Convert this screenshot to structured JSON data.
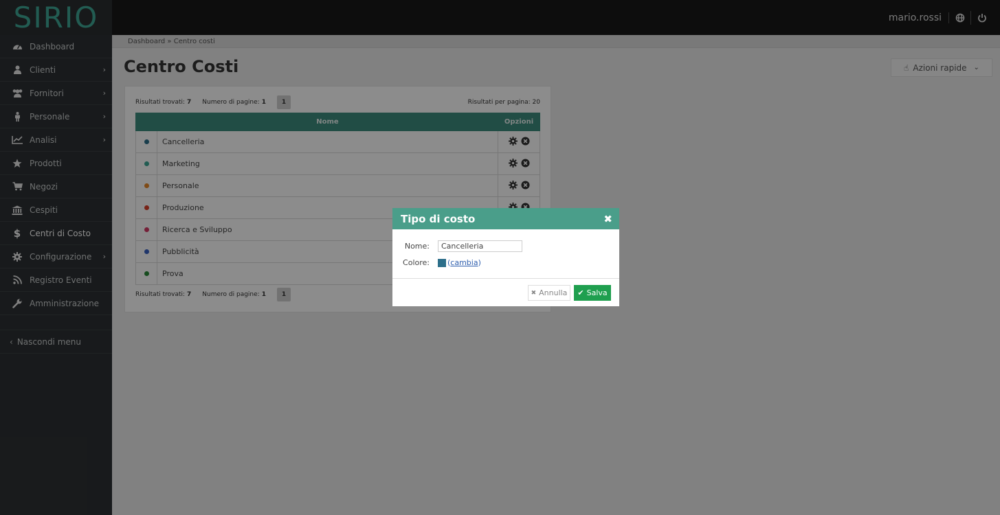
{
  "brand": {
    "logo_text": "SIRIO"
  },
  "header": {
    "username": "mario.rossi",
    "icons": [
      "globe-icon",
      "power-icon"
    ]
  },
  "sidebar": {
    "items": [
      {
        "label": "Dashboard",
        "icon": "dashboard-icon",
        "has_submenu": false
      },
      {
        "label": "Clienti",
        "icon": "user-icon",
        "has_submenu": true
      },
      {
        "label": "Fornitori",
        "icon": "users-icon",
        "has_submenu": true
      },
      {
        "label": "Personale",
        "icon": "person-icon",
        "has_submenu": true
      },
      {
        "label": "Analisi",
        "icon": "chart-line-icon",
        "has_submenu": true
      },
      {
        "label": "Prodotti",
        "icon": "star-icon",
        "has_submenu": false
      },
      {
        "label": "Negozi",
        "icon": "cart-icon",
        "has_submenu": false
      },
      {
        "label": "Cespiti",
        "icon": "bank-icon",
        "has_submenu": false
      },
      {
        "label": "Centri di Costo",
        "icon": "dollar-icon",
        "has_submenu": false,
        "active": true
      },
      {
        "label": "Configurazione",
        "icon": "gear-icon",
        "has_submenu": true
      },
      {
        "label": "Registro Eventi",
        "icon": "rss-icon",
        "has_submenu": false
      },
      {
        "label": "Amministrazione",
        "icon": "wrench-icon",
        "has_submenu": false
      }
    ],
    "hide_menu": "Nascondi menu"
  },
  "breadcrumb": "Dashboard » Centro costi",
  "page": {
    "title": "Centro Costi",
    "quick_actions": "Azioni rapide"
  },
  "results": {
    "found_label": "Risultati trovati:",
    "found_value": "7",
    "pages_label": "Numero di pagine:",
    "pages_value": "1",
    "current_page": "1",
    "per_page": "Risultati per pagina: 20"
  },
  "table": {
    "columns": [
      "",
      "Nome",
      "Opzioni"
    ],
    "rows": [
      {
        "name": "Cancelleria",
        "color": "#2d6f8a"
      },
      {
        "name": "Marketing",
        "color": "#3fa896"
      },
      {
        "name": "Personale",
        "color": "#e8892a"
      },
      {
        "name": "Produzione",
        "color": "#d9402b"
      },
      {
        "name": "Ricerca e Sviluppo",
        "color": "#d63a66"
      },
      {
        "name": "Pubblicità",
        "color": "#3a63c4"
      },
      {
        "name": "Prova",
        "color": "#2a8a3a"
      }
    ]
  },
  "modal": {
    "title": "Tipo di costo",
    "name_label": "Nome:",
    "name_value": "Cancelleria",
    "color_label": "Colore:",
    "color_value": "#2d6f8a",
    "color_link": "cambia",
    "cancel_label": "Annulla",
    "save_label": "Salva"
  }
}
